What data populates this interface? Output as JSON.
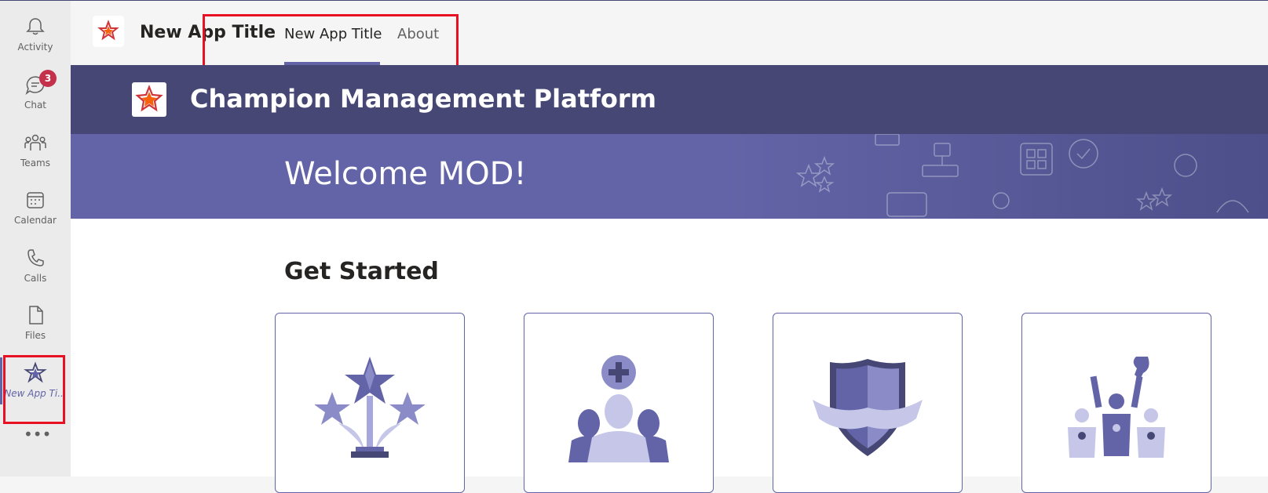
{
  "rail": {
    "items": [
      {
        "label": "Activity",
        "icon": "bell-icon"
      },
      {
        "label": "Chat",
        "icon": "chat-icon",
        "badge": "3"
      },
      {
        "label": "Teams",
        "icon": "teams-icon"
      },
      {
        "label": "Calendar",
        "icon": "calendar-icon"
      },
      {
        "label": "Calls",
        "icon": "phone-icon"
      },
      {
        "label": "Files",
        "icon": "file-icon"
      },
      {
        "label": "New App Ti...",
        "icon": "app-star-icon"
      }
    ],
    "more": "•••"
  },
  "header": {
    "app_title": "New App Title",
    "tabs": [
      {
        "label": "New App Title",
        "active": true
      },
      {
        "label": "About",
        "active": false
      }
    ]
  },
  "banner": {
    "title": "Champion Management Platform"
  },
  "welcome": {
    "text": "Welcome MOD!"
  },
  "main": {
    "section_title": "Get Started",
    "cards": [
      {
        "icon": "stars-trophy-icon"
      },
      {
        "icon": "add-people-icon"
      },
      {
        "icon": "shield-ribbon-icon"
      },
      {
        "icon": "champions-medal-icon"
      }
    ]
  },
  "colors": {
    "accent": "#6264a7",
    "banner": "#464775",
    "highlight_box": "#e81123",
    "badge": "#c4314b"
  }
}
